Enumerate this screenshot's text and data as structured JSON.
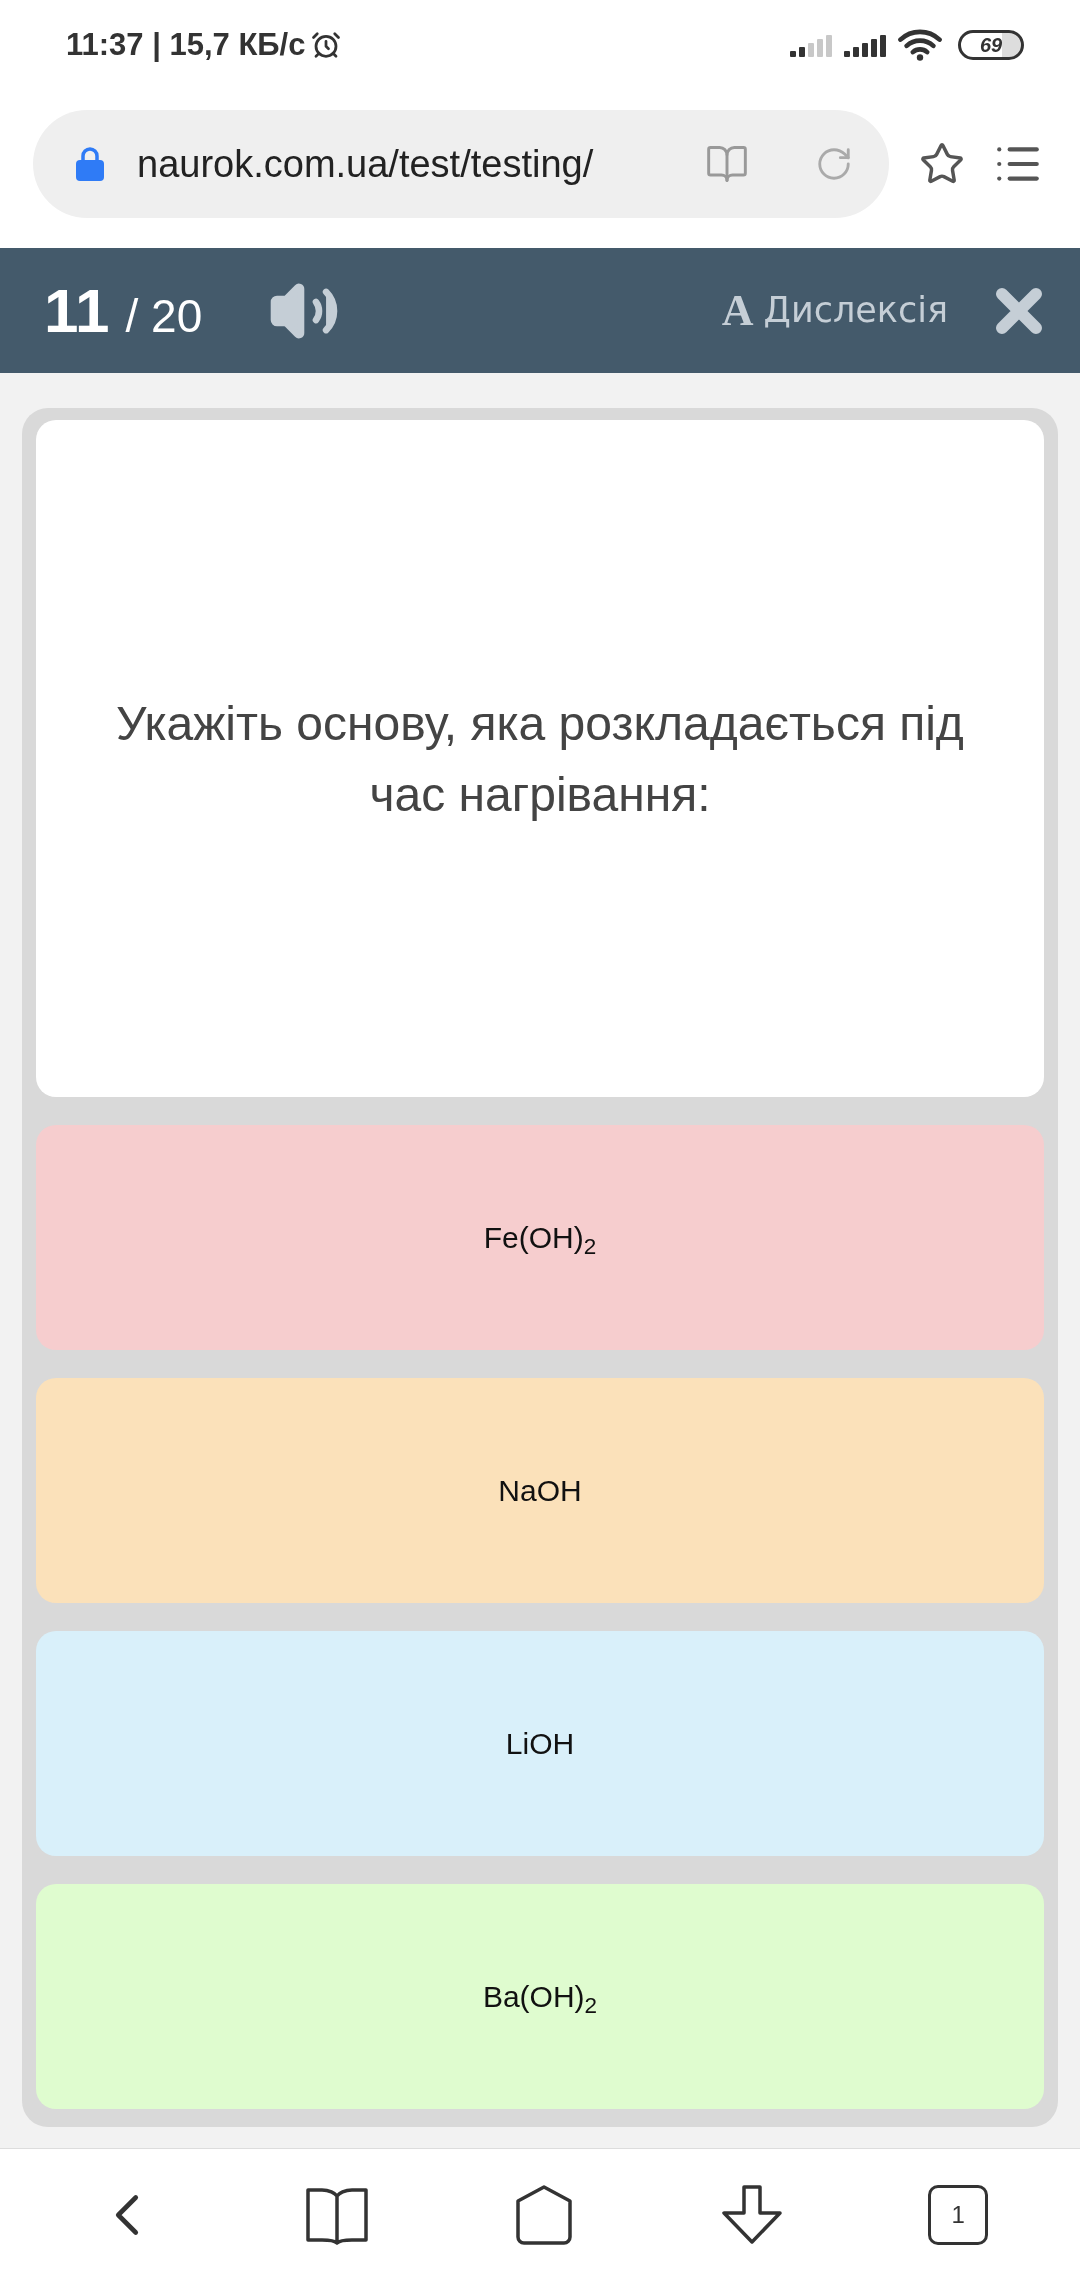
{
  "status_bar": {
    "time_and_speed": "11:37 | 15,7 КБ/с",
    "battery": "69"
  },
  "address_bar": {
    "url": "naurok.com.ua/test/testing/"
  },
  "quiz_header": {
    "current": "11",
    "total": "/ 20",
    "dyslexia_button": {
      "icon_letter": "A",
      "label": "Дислексія"
    }
  },
  "question": "Укажіть основу, яка розкладається під час нагрівання:",
  "answers": [
    {
      "text": "Fe(OH)$_{2}$",
      "color": "#f6cdce"
    },
    {
      "text": "NaOH",
      "color": "#fbe1ba"
    },
    {
      "text": "LiOH",
      "color": "#d9f0fa"
    },
    {
      "text": "Ba(OH)$_{2}$",
      "color": "#dffccf"
    }
  ],
  "bottom_nav": {
    "tab_count": "1"
  }
}
